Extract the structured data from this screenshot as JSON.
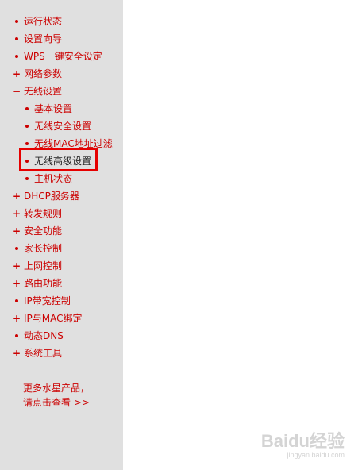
{
  "menu": [
    {
      "label": "运行状态",
      "marker": "bullet",
      "level": 1,
      "name": "menu-item-running-status"
    },
    {
      "label": "设置向导",
      "marker": "bullet",
      "level": 1,
      "name": "menu-item-setup-wizard"
    },
    {
      "label": "WPS一键安全设定",
      "marker": "bullet",
      "level": 1,
      "name": "menu-item-wps"
    },
    {
      "label": "网络参数",
      "marker": "plus",
      "level": 1,
      "name": "menu-item-network-params"
    },
    {
      "label": "无线设置",
      "marker": "minus",
      "level": 1,
      "name": "menu-item-wireless-settings"
    },
    {
      "label": "基本设置",
      "marker": "bullet",
      "level": 2,
      "name": "submenu-item-basic-settings"
    },
    {
      "label": "无线安全设置",
      "marker": "bullet",
      "level": 2,
      "name": "submenu-item-wireless-security"
    },
    {
      "label": "无线MAC地址过滤",
      "marker": "bullet",
      "level": 2,
      "name": "submenu-item-mac-filter"
    },
    {
      "label": "无线高级设置",
      "marker": "bullet",
      "level": 2,
      "name": "submenu-item-wireless-advanced",
      "selected": true
    },
    {
      "label": "主机状态",
      "marker": "bullet",
      "level": 2,
      "name": "submenu-item-host-status"
    },
    {
      "label": "DHCP服务器",
      "marker": "plus",
      "level": 1,
      "name": "menu-item-dhcp-server"
    },
    {
      "label": "转发规则",
      "marker": "plus",
      "level": 1,
      "name": "menu-item-forwarding-rules"
    },
    {
      "label": "安全功能",
      "marker": "plus",
      "level": 1,
      "name": "menu-item-security"
    },
    {
      "label": "家长控制",
      "marker": "bullet",
      "level": 1,
      "name": "menu-item-parental-control"
    },
    {
      "label": "上网控制",
      "marker": "plus",
      "level": 1,
      "name": "menu-item-access-control"
    },
    {
      "label": "路由功能",
      "marker": "plus",
      "level": 1,
      "name": "menu-item-routing"
    },
    {
      "label": "IP带宽控制",
      "marker": "bullet",
      "level": 1,
      "name": "menu-item-bandwidth-control"
    },
    {
      "label": "IP与MAC绑定",
      "marker": "plus",
      "level": 1,
      "name": "menu-item-ip-mac-binding"
    },
    {
      "label": "动态DNS",
      "marker": "bullet",
      "level": 1,
      "name": "menu-item-ddns"
    },
    {
      "label": "系统工具",
      "marker": "plus",
      "level": 1,
      "name": "menu-item-system-tools"
    }
  ],
  "more_link": {
    "line1": "更多水星产品，",
    "line2": "请点击查看 >>"
  },
  "watermark": {
    "main": "Baidu经验",
    "sub": "jingyan.baidu.com"
  },
  "colors": {
    "sidebar_bg": "#e0e0e0",
    "link_red": "#cc0000",
    "highlight_red": "#e60000"
  }
}
